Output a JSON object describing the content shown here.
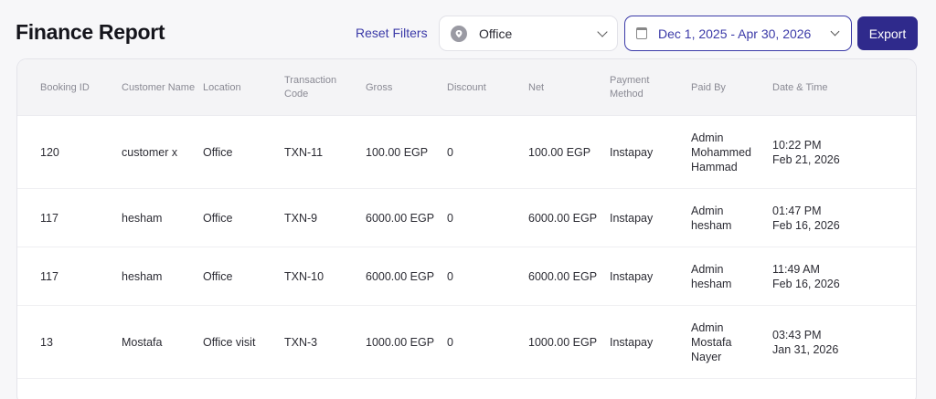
{
  "header": {
    "title": "Finance Report",
    "reset_label": "Reset Filters",
    "location_value": "Office",
    "date_range": "Dec 1, 2025 - Apr 30, 2026",
    "export_label": "Export"
  },
  "table": {
    "columns": [
      "Booking ID",
      "Customer Name",
      "Location",
      "Transaction Code",
      "Gross",
      "Discount",
      "Net",
      "Payment Method",
      "Paid By",
      "Date & Time"
    ],
    "rows": [
      {
        "booking_id": "120",
        "customer": "customer x",
        "location": "Office",
        "txn": "TXN-11",
        "gross": "100.00 EGP",
        "discount": "0",
        "net": "100.00 EGP",
        "method": "Instapay",
        "paid_by": "Admin Mohammed Hammad",
        "time": "10:22 PM",
        "date": "Feb 21, 2026"
      },
      {
        "booking_id": "117",
        "customer": "hesham",
        "location": "Office",
        "txn": "TXN-9",
        "gross": "6000.00 EGP",
        "discount": "0",
        "net": "6000.00 EGP",
        "method": "Instapay",
        "paid_by": "Admin hesham",
        "time": "01:47 PM",
        "date": "Feb 16, 2026"
      },
      {
        "booking_id": "117",
        "customer": "hesham",
        "location": "Office",
        "txn": "TXN-10",
        "gross": "6000.00 EGP",
        "discount": "0",
        "net": "6000.00 EGP",
        "method": "Instapay",
        "paid_by": "Admin hesham",
        "time": "11:49 AM",
        "date": "Feb 16, 2026"
      },
      {
        "booking_id": "13",
        "customer": "Mostafa",
        "location": "Office visit",
        "txn": "TXN-3",
        "gross": "1000.00 EGP",
        "discount": "0",
        "net": "1000.00 EGP",
        "method": "Instapay",
        "paid_by": "Admin Mostafa Nayer",
        "time": "03:43 PM",
        "date": "Jan 31, 2026"
      }
    ]
  },
  "colors": {
    "accent": "#3b3aa8",
    "export_bg": "#2f2a8c"
  },
  "icons": {
    "location": "location-pin-icon",
    "calendar": "calendar-icon",
    "chevron": "chevron-down-icon"
  }
}
